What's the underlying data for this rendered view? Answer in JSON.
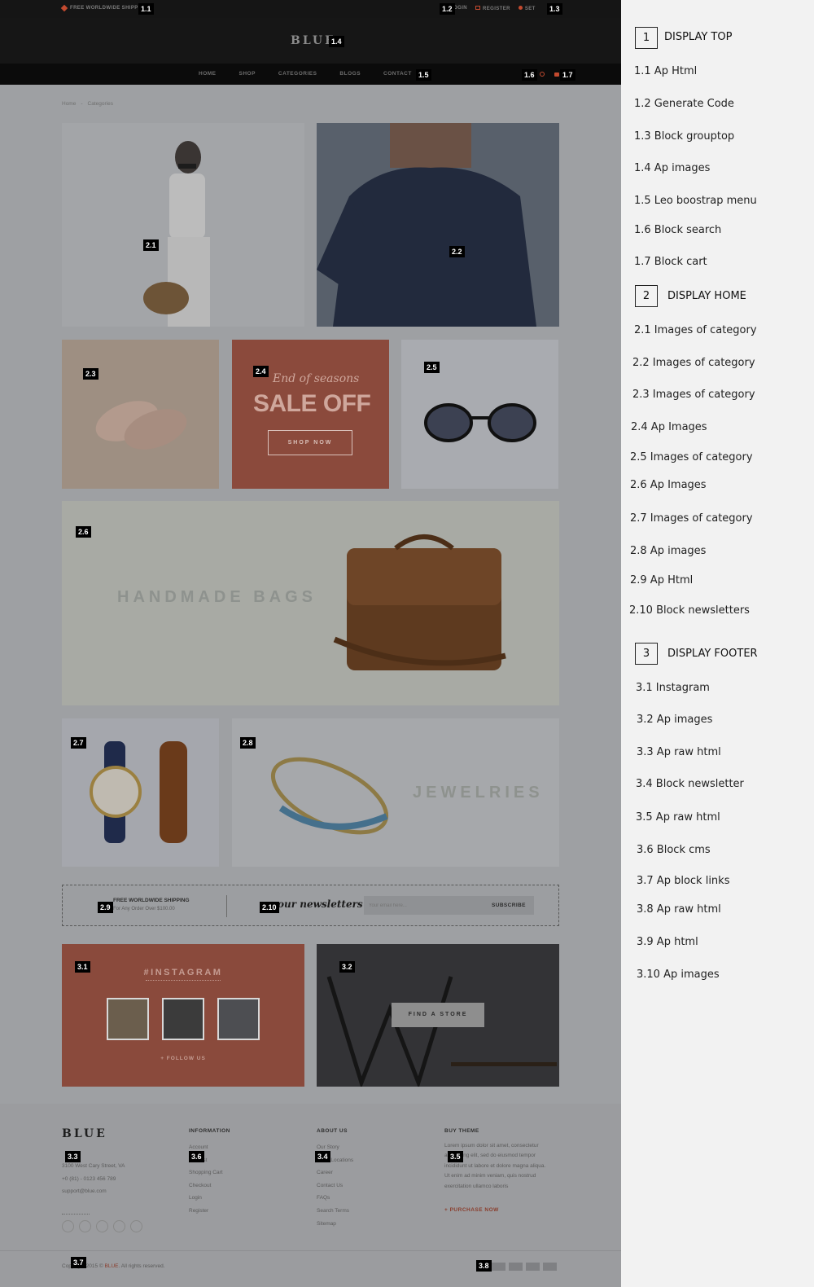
{
  "top": {
    "shipping": "FREE WORLDWIDE SHIPPIG",
    "login": "LOGIN",
    "register": "REGISTER",
    "settings": "SET"
  },
  "logo": "BLUE",
  "nav": [
    "HOME",
    "SHOP",
    "CATEGORIES",
    "BLOGS",
    "CONTACT"
  ],
  "breadcrumb": [
    "Home",
    "Categories"
  ],
  "promo": {
    "script": "End of seasons",
    "headline": "SALE OFF",
    "button": "SHOP NOW"
  },
  "bags_label": "HANDMADE BAGS",
  "jewelries_label": "JEWELRIES",
  "newsletter": {
    "ship_title": "FREE WORLDWIDE SHIPPING",
    "ship_sub": "For Any Order Over $100.00",
    "heading": "our newsletters",
    "placeholder": "Your email here...",
    "button": "SUBSCRIBE"
  },
  "instagram": {
    "title": "#INSTAGRAM",
    "follow": "+ FOLLOW US"
  },
  "store_button": "FIND A STORE",
  "footer": {
    "logo": "BLUE",
    "address": [
      "3100 West Cary Street, VA",
      "+0 (81) - 0123 456 789",
      "support@blue.com"
    ],
    "information_title": "INFORMATION",
    "information": [
      "Account",
      "Wishlist",
      "Shopping Cart",
      "Checkout",
      "Login",
      "Register"
    ],
    "about_title": "ABOUT US",
    "about": [
      "Our Story",
      "Store Locations",
      "Career",
      "Contact Us",
      "FAQs",
      "Search Terms",
      "Sitemap"
    ],
    "buy_title": "BUY THEME",
    "buy_text": [
      "Lorem ipsum dolor sit amet, consectetur",
      "adipisicing elit, sed do eiusmod tempor",
      "incididunt ut labore et dolore magna aliqua.",
      "Ut enim ad minim veniam, quis nostrud",
      "exercitation ullamco laboris"
    ],
    "purchase": "+ PURCHASE NOW",
    "copyright_a": "Copyright 2015 © ",
    "copyright_brand": "BLUE",
    "copyright_b": ". All rights reserved."
  },
  "tags": {
    "t1_1": "1.1",
    "t1_2": "1.2",
    "t1_3": "1.3",
    "t1_4": "1.4",
    "t1_5": "1.5",
    "t1_6": "1.6",
    "t1_7": "1.7",
    "t2_1": "2.1",
    "t2_2": "2.2",
    "t2_3": "2.3",
    "t2_4": "2.4",
    "t2_5": "2.5",
    "t2_6": "2.6",
    "t2_7": "2.7",
    "t2_8": "2.8",
    "t2_9": "2.9",
    "t2_10": "2.10",
    "t3_1": "3.1",
    "t3_2": "3.2",
    "t3_3": "3.3",
    "t3_4": "3.4",
    "t3_5": "3.5",
    "t3_6": "3.6",
    "t3_7": "3.7",
    "t3_8": "3.8"
  },
  "legend": {
    "s1_num": "1",
    "s1_title": "DISPLAY TOP",
    "s1_items": [
      "1.1 Ap Html",
      "1.2 Generate Code",
      "1.3 Block grouptop",
      "1.4 Ap images",
      "1.5 Leo boostrap menu",
      "1.6 Block search",
      "1.7 Block cart"
    ],
    "s2_num": "2",
    "s2_title": "DISPLAY HOME",
    "s2_items": [
      "2.1 Images of category",
      "2.2 Images of category",
      "2.3 Images of category",
      "2.4 Ap Images",
      "2.5 Images of category",
      "2.6 Ap Images",
      "2.7 Images of category",
      "2.8 Ap images",
      "2.9 Ap Html",
      "2.10 Block newsletters"
    ],
    "s3_num": "3",
    "s3_title": "DISPLAY FOOTER",
    "s3_items": [
      "3.1  Instagram",
      "3.2 Ap images",
      "3.3  Ap raw html",
      "3.4  Block newsletter",
      "3.5 Ap raw html",
      "3.6 Block cms",
      "3.7 Ap block links",
      "3.8 Ap raw html",
      "3.9 Ap  html",
      "3.10 Ap images"
    ]
  },
  "colors": {
    "accent": "#c44a2f",
    "dark": "#151515",
    "legend_bg": "#f2f2f2"
  }
}
